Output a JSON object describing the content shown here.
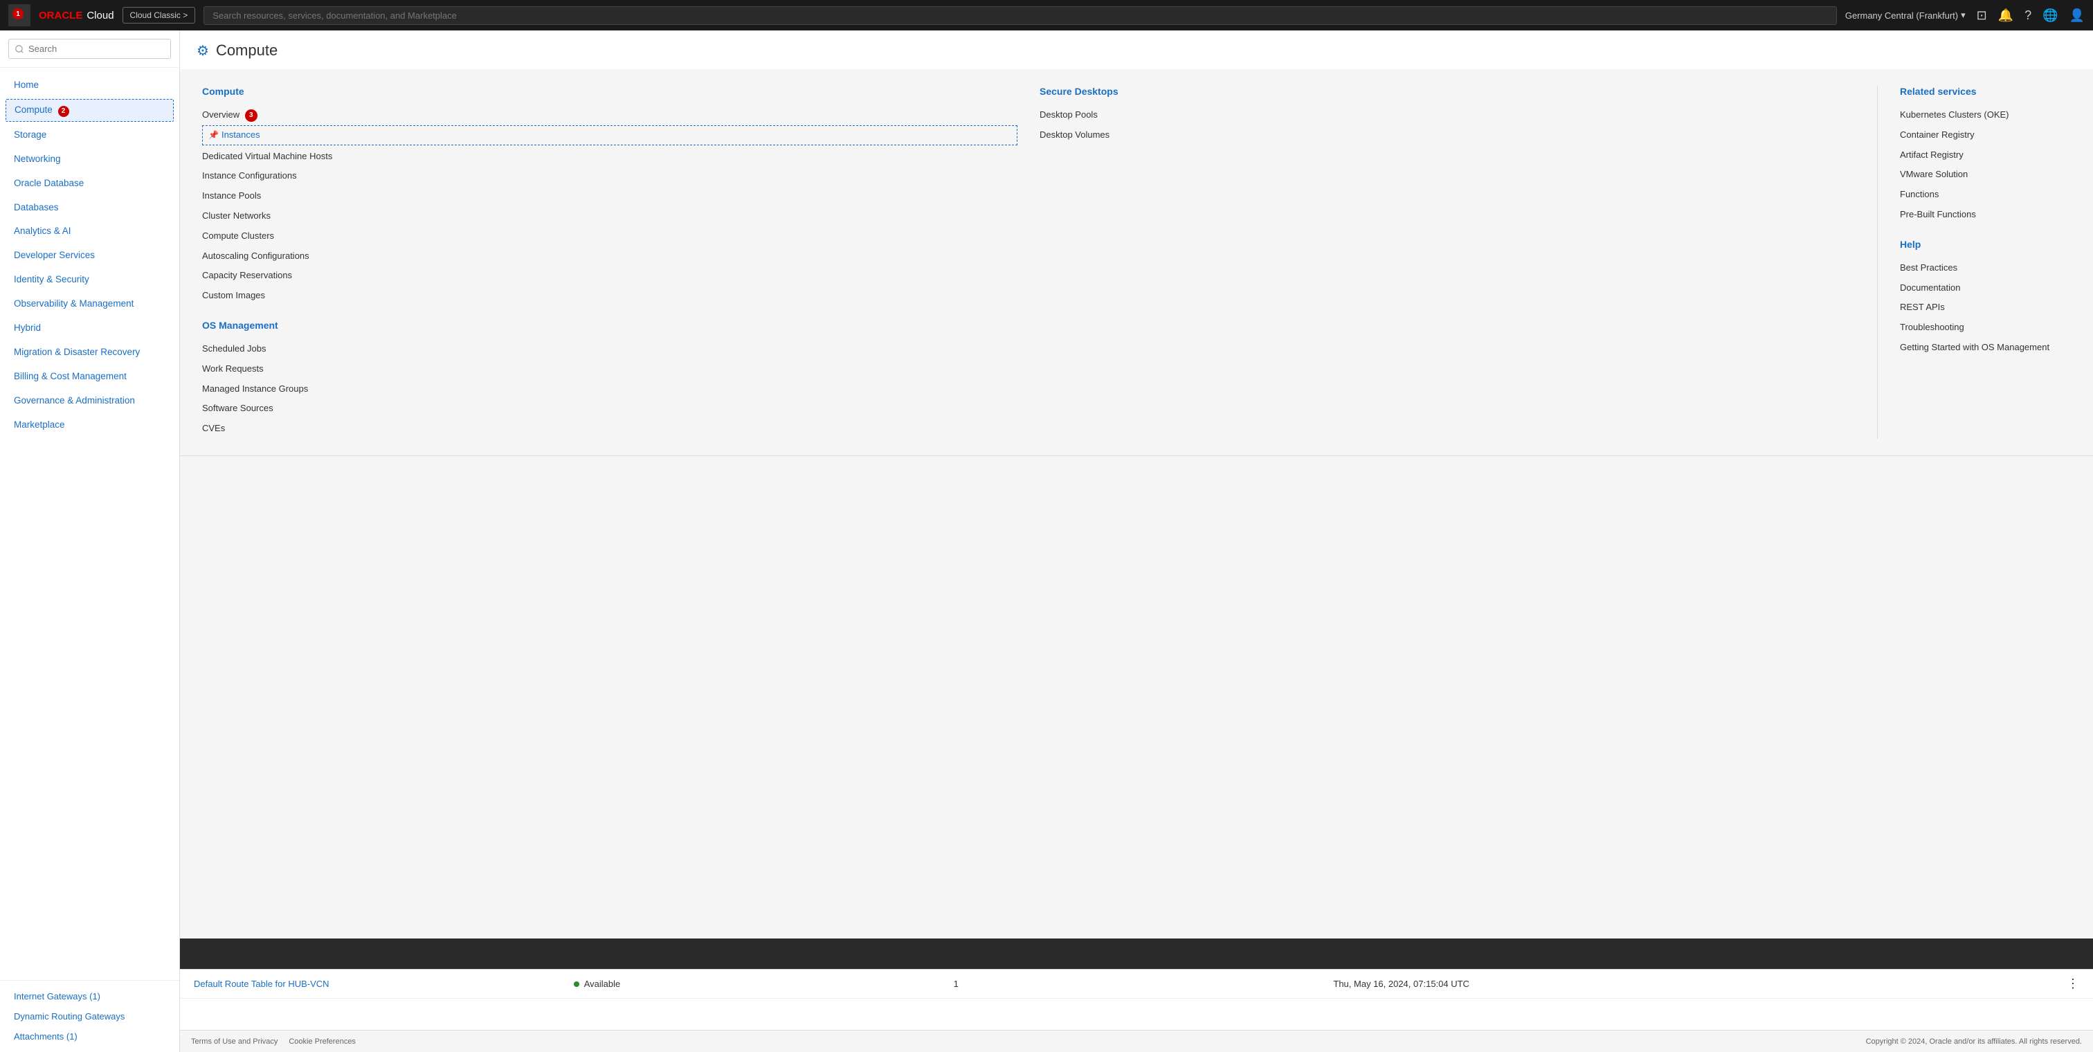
{
  "navbar": {
    "close_btn": "✕",
    "badge_1": "1",
    "logo_oracle": "ORACLE",
    "logo_cloud": "Cloud",
    "classic_btn": "Cloud Classic >",
    "search_placeholder": "Search resources, services, documentation, and Marketplace",
    "region": "Germany Central (Frankfurt)",
    "region_chevron": "▾"
  },
  "sidebar": {
    "search_placeholder": "Search",
    "items": [
      {
        "id": "home",
        "label": "Home",
        "active": false
      },
      {
        "id": "compute",
        "label": "Compute",
        "active": true,
        "badge": "2"
      },
      {
        "id": "storage",
        "label": "Storage",
        "active": false
      },
      {
        "id": "networking",
        "label": "Networking",
        "active": false
      },
      {
        "id": "oracle-database",
        "label": "Oracle Database",
        "active": false
      },
      {
        "id": "databases",
        "label": "Databases",
        "active": false
      },
      {
        "id": "analytics-ai",
        "label": "Analytics & AI",
        "active": false
      },
      {
        "id": "developer-services",
        "label": "Developer Services",
        "active": false
      },
      {
        "id": "identity-security",
        "label": "Identity & Security",
        "active": false
      },
      {
        "id": "observability",
        "label": "Observability & Management",
        "active": false
      },
      {
        "id": "hybrid",
        "label": "Hybrid",
        "active": false
      },
      {
        "id": "migration",
        "label": "Migration & Disaster Recovery",
        "active": false
      },
      {
        "id": "billing",
        "label": "Billing & Cost Management",
        "active": false
      },
      {
        "id": "governance",
        "label": "Governance & Administration",
        "active": false
      },
      {
        "id": "marketplace",
        "label": "Marketplace",
        "active": false
      }
    ],
    "bottom_items": [
      {
        "id": "internet-gateways",
        "label": "Internet Gateways (1)"
      },
      {
        "id": "dynamic-routing",
        "label": "Dynamic Routing Gateways"
      },
      {
        "id": "attachments",
        "label": "Attachments (1)"
      }
    ]
  },
  "page_header": {
    "icon": "⚙",
    "title": "Compute"
  },
  "mega_menu": {
    "compute_section": {
      "title": "Compute",
      "links": [
        {
          "id": "overview",
          "label": "Overview",
          "badge": "3"
        },
        {
          "id": "instances",
          "label": "Instances",
          "pinned": true
        },
        {
          "id": "dedicated-vm-hosts",
          "label": "Dedicated Virtual Machine Hosts"
        },
        {
          "id": "instance-configurations",
          "label": "Instance Configurations"
        },
        {
          "id": "instance-pools",
          "label": "Instance Pools"
        },
        {
          "id": "cluster-networks",
          "label": "Cluster Networks"
        },
        {
          "id": "compute-clusters",
          "label": "Compute Clusters"
        },
        {
          "id": "autoscaling-configurations",
          "label": "Autoscaling Configurations"
        },
        {
          "id": "capacity-reservations",
          "label": "Capacity Reservations"
        },
        {
          "id": "custom-images",
          "label": "Custom Images"
        }
      ]
    },
    "os_management_section": {
      "title": "OS Management",
      "links": [
        {
          "id": "scheduled-jobs",
          "label": "Scheduled Jobs"
        },
        {
          "id": "work-requests",
          "label": "Work Requests"
        },
        {
          "id": "managed-instance-groups",
          "label": "Managed Instance Groups"
        },
        {
          "id": "software-sources",
          "label": "Software Sources"
        },
        {
          "id": "cves",
          "label": "CVEs"
        }
      ]
    },
    "secure_desktops_section": {
      "title": "Secure Desktops",
      "links": [
        {
          "id": "desktop-pools",
          "label": "Desktop Pools"
        },
        {
          "id": "desktop-volumes",
          "label": "Desktop Volumes"
        }
      ]
    },
    "related_services": {
      "title": "Related services",
      "links": [
        {
          "id": "kubernetes",
          "label": "Kubernetes Clusters (OKE)"
        },
        {
          "id": "container-registry",
          "label": "Container Registry"
        },
        {
          "id": "artifact-registry",
          "label": "Artifact Registry"
        },
        {
          "id": "vmware-solution",
          "label": "VMware Solution"
        },
        {
          "id": "functions",
          "label": "Functions"
        },
        {
          "id": "pre-built-functions",
          "label": "Pre-Built Functions"
        }
      ]
    },
    "help": {
      "title": "Help",
      "links": [
        {
          "id": "best-practices",
          "label": "Best Practices"
        },
        {
          "id": "documentation",
          "label": "Documentation"
        },
        {
          "id": "rest-apis",
          "label": "REST APIs"
        },
        {
          "id": "troubleshooting",
          "label": "Troubleshooting"
        },
        {
          "id": "getting-started",
          "label": "Getting Started with OS Management"
        }
      ]
    }
  },
  "table": {
    "row": {
      "link": "Default Route Table for HUB-VCN",
      "status": "Available",
      "count": "1",
      "timestamp": "Thu, May 16, 2024, 07:15:04 UTC"
    }
  },
  "footer": {
    "links": [
      "Terms of Use and Privacy",
      "Cookie Preferences"
    ],
    "copyright": "Copyright © 2024, Oracle and/or its affiliates. All rights reserved."
  }
}
